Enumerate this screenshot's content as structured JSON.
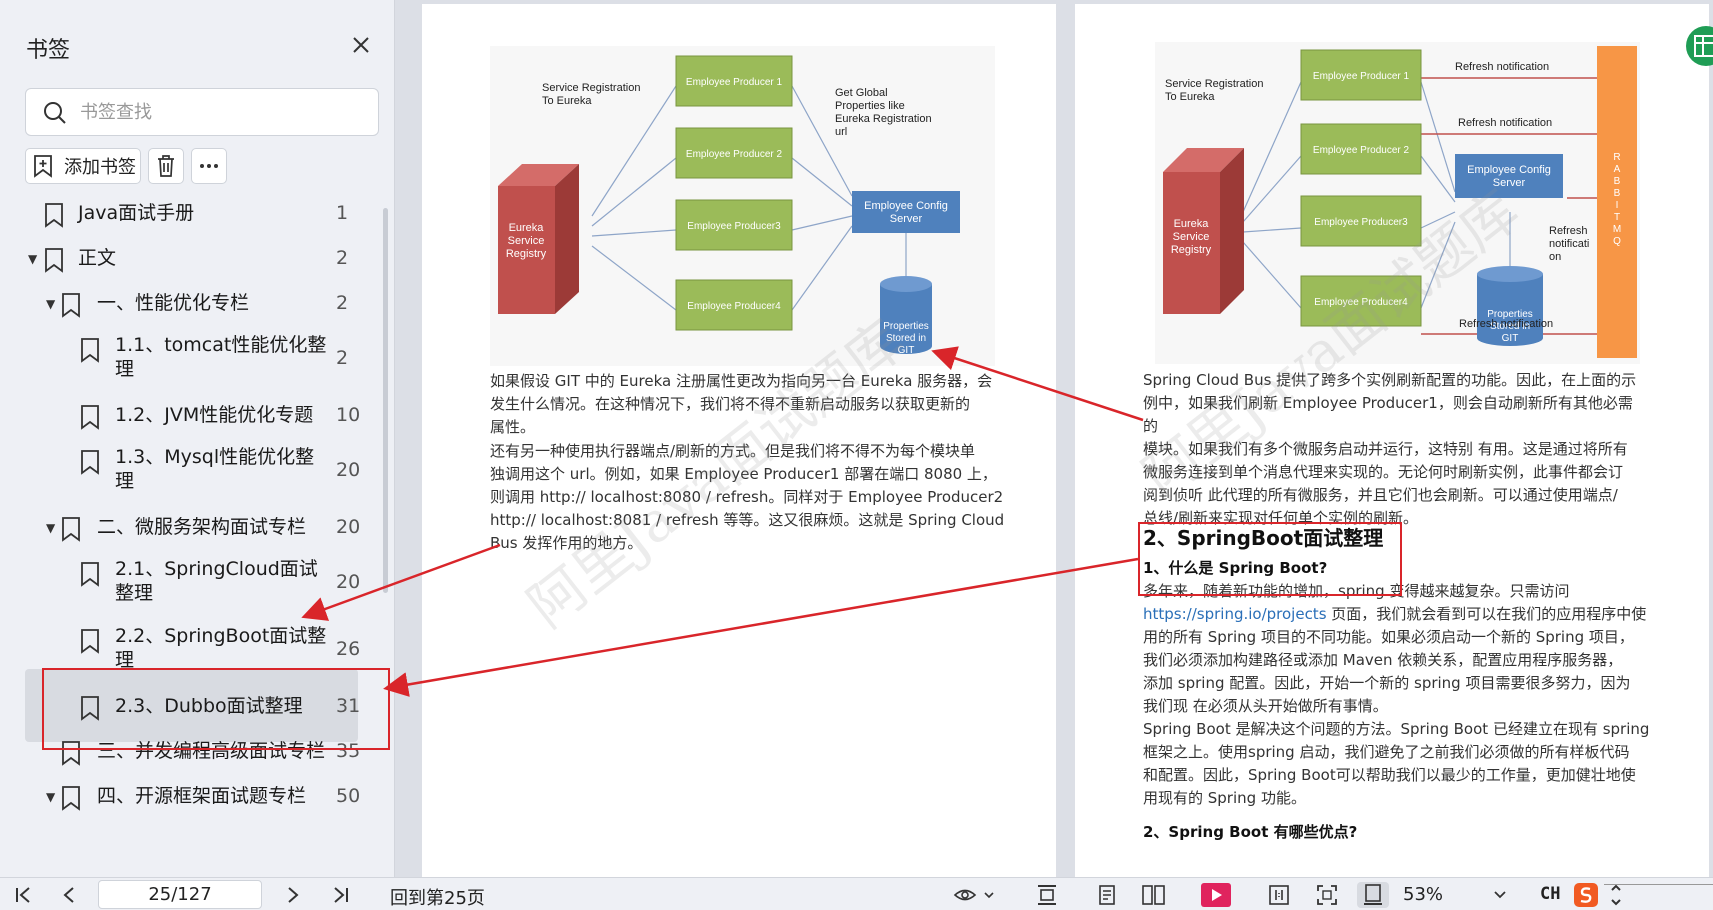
{
  "sidebar": {
    "title": "书签",
    "search_placeholder": "书签查找",
    "add_label": "添加书签",
    "items": [
      {
        "title": "Java面试手册",
        "page": "1"
      },
      {
        "title": "正文",
        "page": "2"
      },
      {
        "title": "一、性能优化专栏",
        "page": "2"
      },
      {
        "title": "1.1、tomcat性能优化整",
        "title2": "理",
        "page": "2"
      },
      {
        "title": "1.2、JVM性能优化专题",
        "page": "10"
      },
      {
        "title": "1.3、Mysql性能优化整",
        "title2": "理",
        "page": "20"
      },
      {
        "title": "二、微服务架构面试专栏",
        "page": "20"
      },
      {
        "title": "2.1、SpringCloud面试",
        "title2": "整理",
        "page": "20"
      },
      {
        "title": "2.2、SpringBoot面试整",
        "title2": "理",
        "page": "26"
      },
      {
        "title": "2.3、Dubbo面试整理",
        "page": "31"
      },
      {
        "title": "三、并发编程高级面试专栏",
        "page": "35"
      },
      {
        "title": "四、开源框架面试题专栏",
        "page": "50"
      }
    ]
  },
  "diagram_left": {
    "label_registration": [
      "Service Registration",
      "To Eureka"
    ],
    "label_global": [
      "Get Global",
      "Properties like",
      "Eureka Registration",
      "url"
    ],
    "eureka": [
      "Eureka",
      "Service",
      "Registry"
    ],
    "producers": [
      "Employee Producer 1",
      "Employee Producer 2",
      "Employee Producer3",
      "Employee Producer4"
    ],
    "config": [
      "Employee Config",
      "Server"
    ],
    "git": [
      "Properties",
      "Stored in",
      "GIT"
    ]
  },
  "diagram_right": {
    "label_registration": [
      "Service Registration",
      "To Eureka"
    ],
    "eureka": [
      "Eureka",
      "Service",
      "Registry"
    ],
    "producers": [
      "Employee Producer 1",
      "Employee Producer 2",
      "Employee Producer3",
      "Employee Producer4"
    ],
    "config": [
      "Employee Config",
      "Server"
    ],
    "git": [
      "Properties",
      "Stored in",
      "GIT"
    ],
    "refresh": [
      "Refresh notification",
      "Refresh notification",
      "Refresh notification"
    ],
    "refresh_side": [
      "Refresh",
      "notificati",
      "on"
    ],
    "rabbit": [
      "R",
      "A",
      "B",
      "B",
      "I",
      "T",
      "M",
      "Q"
    ]
  },
  "left_page": {
    "para1": [
      "如果假设 GIT 中的 Eureka 注册属性更改为指向另一台 Eureka 服务器，会",
      "发生什么情况。在这种情况下，我们将不得不重新启动服务以获取更新的",
      "属性。"
    ],
    "para2": [
      "还有另一种使用执行器端点/刷新的方式。但是我们将不得不为每个模块单",
      "独调用这个 url。例如，如果 Employee Producer1 部署在端口 8080 上，",
      "则调用 http:// localhost:8080 / refresh。同样对于 Employee Producer2",
      "http:// localhost:8081 / refresh 等等。这又很麻烦。这就是 Spring Cloud",
      "Bus 发挥作用的地方。"
    ]
  },
  "right_page": {
    "para1": [
      "Spring Cloud Bus 提供了跨多个实例刷新配置的功能。因此，在上面的示",
      "例中，如果我们刷新 Employee Producer1，则会自动刷新所有其他必需的",
      "模块。如果我们有多个微服务启动并运行，这特别 有用。这是通过将所有",
      "微服务连接到单个消息代理来实现的。无论何时刷新实例，此事件都会订",
      "阅到侦听 此代理的所有微服务，并且它们也会刷新。可以通过使用端点/",
      "总线/刷新来实现对任何单个实例的刷新。"
    ],
    "heading": "2、SpringBoot面试整理",
    "q1": "1、什么是 Spring Boot?",
    "para2_first": "多年来，随着新功能的增加，spring 变得越来越复杂。只需访问",
    "link": "https://spring.io/projects",
    "para2_link_rest": " 页面，我们就会看到可以在我们的应用程序中使",
    "para2_rest": [
      "用的所有 Spring 项目的不同功能。如果必须启动一个新的 Spring 项目，",
      "我们必须添加构建路径或添加 Maven 依赖关系，配置应用程序服务器，",
      "添加 spring 配置。因此，开始一个新的 spring 项目需要很多努力，因为",
      "我们现 在必须从头开始做所有事情。",
      "Spring Boot 是解决这个问题的方法。Spring Boot 已经建立在现有 spring",
      "框架之上。使用spring 启动，我们避免了之前我们必须做的所有样板代码",
      "和配置。因此，Spring Boot可以帮助我们以最少的工作量，更加健壮地使",
      "用现有的 Spring 功能。"
    ],
    "q2": "2、Spring Boot 有哪些优点?"
  },
  "watermark": "阿里Java面试题库",
  "statusbar": {
    "page_value": "25/127",
    "back_label": "回到第25页",
    "zoom": "53%",
    "ime": "CH"
  },
  "colors": {
    "annotation_red": "#d9252a",
    "producer_green": "#9bbb59",
    "eureka_red": "#c0504d",
    "config_blue": "#4f81bd",
    "rabbit_orange": "#f79646"
  }
}
